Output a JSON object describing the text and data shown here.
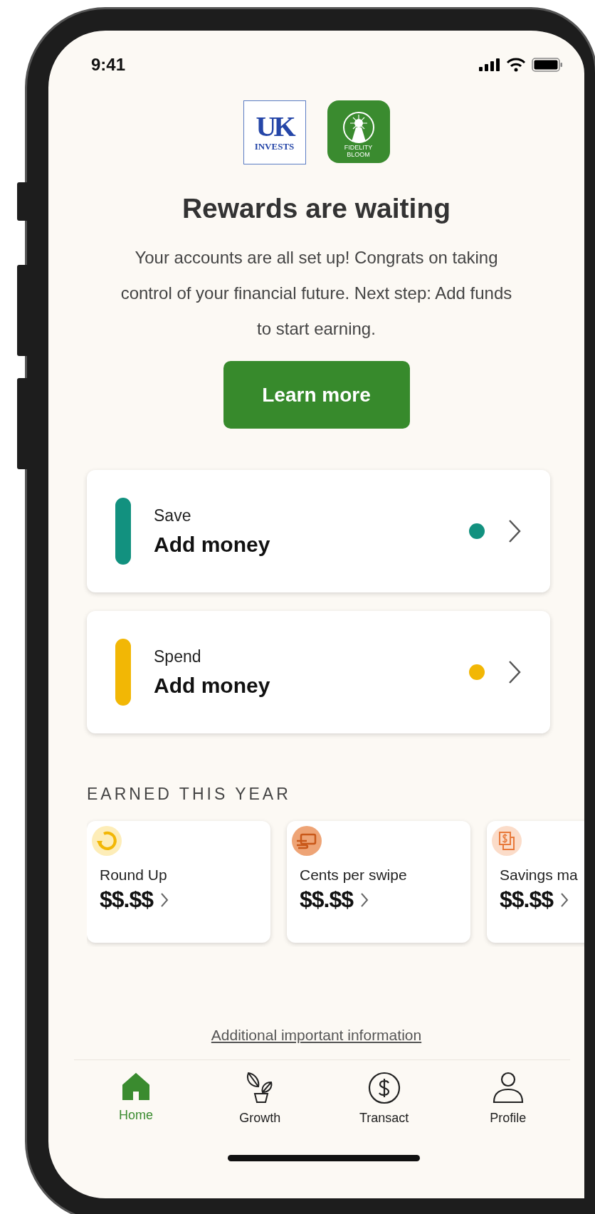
{
  "status_bar": {
    "time": "9:41"
  },
  "logos": {
    "partner": {
      "mark": "UK",
      "caption": "INVESTS"
    },
    "app": {
      "caption_line1": "FIDELITY",
      "caption_line2": "BLOOM"
    }
  },
  "title": "Rewards are waiting",
  "message": "Your accounts are all set up! Congrats on taking control of your financial future. Next step: Add funds to start earning.",
  "primary_button": "Learn more",
  "accounts": [
    {
      "label": "Save",
      "action": "Add money",
      "color": "#12917f"
    },
    {
      "label": "Spend",
      "action": "Add money",
      "color": "#f2b705"
    }
  ],
  "earned": {
    "heading": "EARNED THIS YEAR",
    "items": [
      {
        "kind": "round-up",
        "label": "Round Up",
        "amount": "$$.$$"
      },
      {
        "kind": "swipe",
        "label": "Cents per swipe",
        "amount": "$$.$$"
      },
      {
        "kind": "match",
        "label": "Savings ma",
        "amount": "$$.$$"
      }
    ]
  },
  "footer_link": "Additional important information",
  "nav": [
    {
      "kind": "home",
      "label": "Home",
      "selected": true
    },
    {
      "kind": "growth",
      "label": "Growth",
      "selected": false
    },
    {
      "kind": "transact",
      "label": "Transact",
      "selected": false
    },
    {
      "kind": "profile",
      "label": "Profile",
      "selected": false
    }
  ]
}
